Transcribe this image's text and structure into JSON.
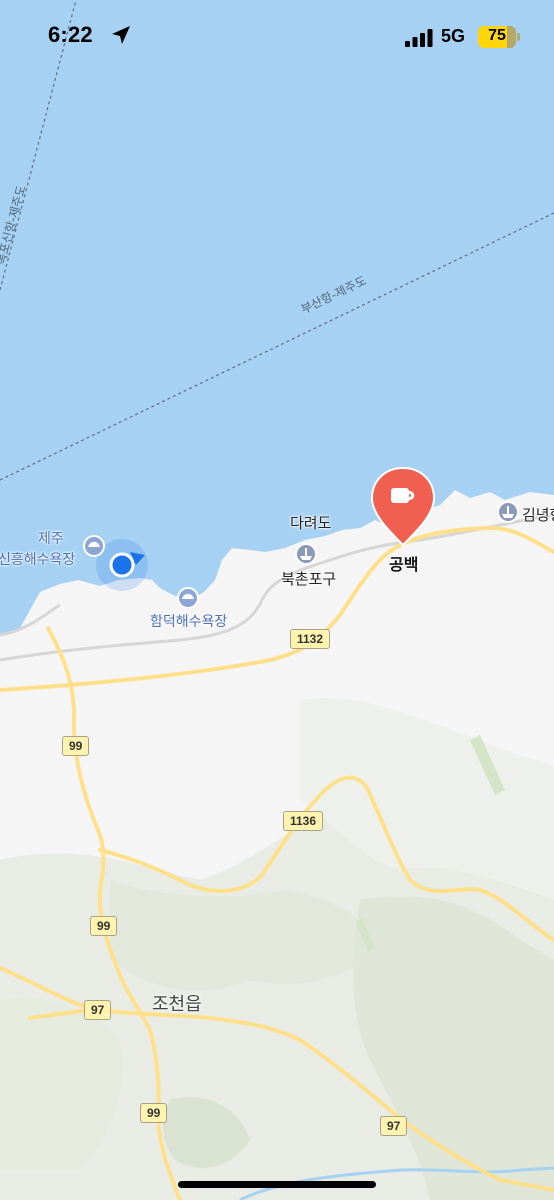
{
  "status_bar": {
    "time": "6:22",
    "network": "5G",
    "battery_level": "75",
    "battery_fraction": 0.75
  },
  "map": {
    "selected_place": {
      "name": "공백",
      "marker_icon": "coffee-cup-icon",
      "marker_color": "#f05f4f"
    },
    "places": {
      "jeju": "제주",
      "sinheung_beach": "신흥해수욕장",
      "hamdeok_beach": "함덕해수욕장",
      "dareodo": "다려도",
      "bukchon_port": "북촌포구",
      "gimnyeong": "김녕항",
      "jocheon": "조천읍"
    },
    "ferry_routes": {
      "busan_jeju": "부산항-제주도",
      "other_jeju": "목포신항-제주도"
    },
    "road_numbers": {
      "r1132": "1132",
      "r1136": "1136",
      "r99_a": "99",
      "r99_b": "99",
      "r99_c": "99",
      "r97_a": "97",
      "r97_b": "97"
    },
    "colors": {
      "sea": "#a6d1f2",
      "land": "#f5f5f5",
      "road": "#ffe08a",
      "user_location": "#1a73e8"
    }
  }
}
